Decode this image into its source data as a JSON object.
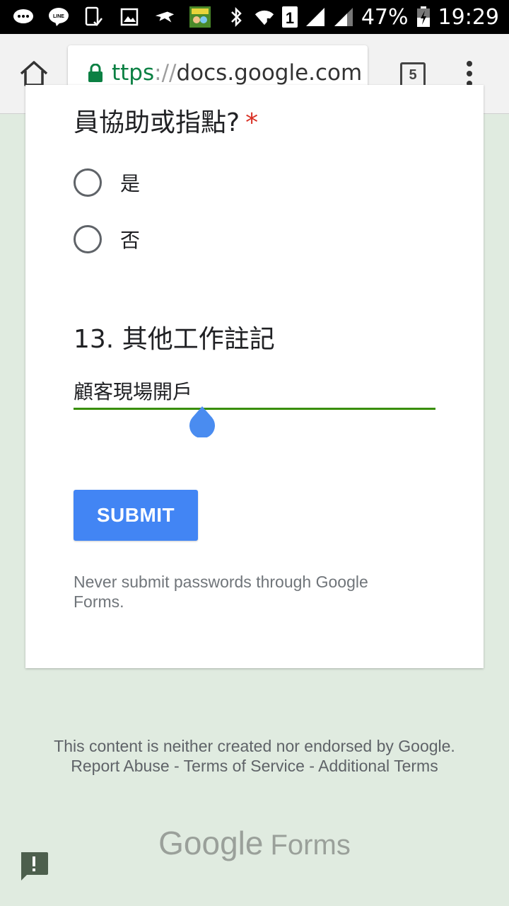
{
  "status_bar": {
    "battery": "47%",
    "time": "19:29",
    "sim_number": "1",
    "left_icons": [
      "chat-bubble-icon",
      "line-icon",
      "tablet-check-icon",
      "image-icon",
      "bird-icon",
      "game-app-icon"
    ],
    "right_icons": [
      "bluetooth-icon",
      "wifi-icon",
      "sim-icon",
      "signal-icon",
      "signal-icon-2",
      "battery-icon"
    ]
  },
  "browser": {
    "url_scheme": "ttps",
    "url_sep": "://",
    "url_host": "docs.google.com",
    "tab_count": "5",
    "accent_color": "#0b8043"
  },
  "form": {
    "question_12": {
      "title_fragment": "員協助或指點?",
      "required_mark": "*",
      "options": [
        {
          "label": "是",
          "selected": false
        },
        {
          "label": "否",
          "selected": false
        }
      ]
    },
    "question_13": {
      "title": "13. 其他工作註記",
      "answer_value": "顧客現場開戶",
      "underline_color": "#388e05"
    },
    "submit_label": "SUBMIT",
    "submit_color": "#4285f4",
    "password_note": "Never submit passwords through Google Forms."
  },
  "footer": {
    "disclaimer_text": "This content is neither created nor endorsed by Google.",
    "report_abuse": "Report Abuse",
    "terms_of_service": "Terms of Service",
    "additional_terms": "Additional Terms",
    "separator": " - ",
    "logo_google": "Google",
    "logo_forms": "Forms"
  }
}
